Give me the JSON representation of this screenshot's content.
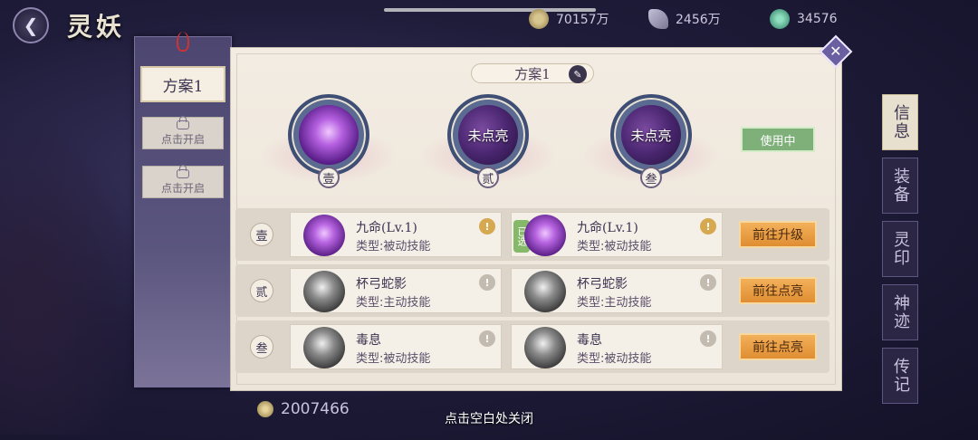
{
  "screen": {
    "title": "灵妖",
    "close_hint": "点击空白处关闭",
    "bottom_coin_value": "2007466"
  },
  "currencies": [
    {
      "icon": "coin-icon",
      "value": "70157万"
    },
    {
      "icon": "feather-icon",
      "value": "2456万"
    },
    {
      "icon": "jade-icon",
      "value": "34576"
    }
  ],
  "right_tabs": [
    "信息",
    "装备",
    "灵印",
    "神迹",
    "传记"
  ],
  "schemes": {
    "active_label": "方案1",
    "locked_label": "点击开启"
  },
  "panel": {
    "plan_title": "方案1",
    "in_use_label": "使用中",
    "orbs": [
      {
        "num": "壹",
        "state": "lit",
        "label": ""
      },
      {
        "num": "贰",
        "state": "unlit",
        "label": "未点亮"
      },
      {
        "num": "叁",
        "state": "unlit",
        "label": "未点亮"
      }
    ],
    "selected_tag": "已选",
    "rows": [
      {
        "num": "壹",
        "left": {
          "name": "九命(Lv.1)",
          "type": "类型:被动技能",
          "icon": "nine-lives-icon"
        },
        "right": {
          "name": "九命(Lv.1)",
          "type": "类型:被动技能",
          "icon": "nine-lives-icon"
        },
        "action": "前往升级"
      },
      {
        "num": "贰",
        "left": {
          "name": "杯弓蛇影",
          "type": "类型:主动技能",
          "icon": "snake-shadow-icon"
        },
        "right": {
          "name": "杯弓蛇影",
          "type": "类型:主动技能",
          "icon": "snake-shadow-icon"
        },
        "action": "前往点亮"
      },
      {
        "num": "叁",
        "left": {
          "name": "毒息",
          "type": "类型:被动技能",
          "icon": "poison-breath-icon"
        },
        "right": {
          "name": "毒息",
          "type": "类型:被动技能",
          "icon": "poison-breath-icon"
        },
        "action": "前往点亮"
      }
    ]
  }
}
